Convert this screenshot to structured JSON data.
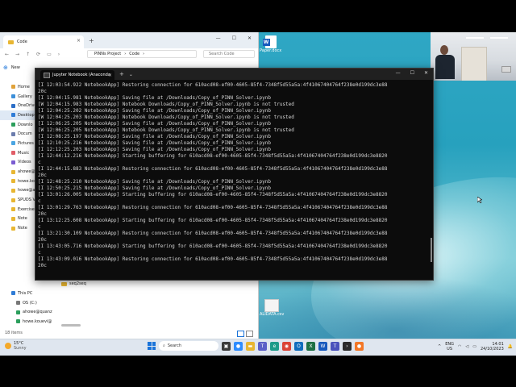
{
  "explorer": {
    "tab_title": "Code",
    "close": "×",
    "new_tab": "+",
    "window_controls": [
      "—",
      "☐",
      "✕"
    ],
    "nav": [
      "←",
      "→",
      "↑",
      "⟳",
      "▭",
      "›"
    ],
    "breadcrumb": [
      "PINNs Project",
      "›",
      "Code",
      "›"
    ],
    "search_placeholder": "Search Code",
    "new_button": "New",
    "sidebar": [
      {
        "label": "Home",
        "color": "#e0a23a"
      },
      {
        "label": "Gallery",
        "color": "#3c8fd9"
      },
      {
        "label": "OneDrive",
        "color": "#2b6ec7"
      },
      {
        "label": "Desktop",
        "color": "#2f7cd6"
      },
      {
        "label": "Downlo",
        "color": "#2b9e5c"
      },
      {
        "label": "Docum",
        "color": "#6b7cad"
      },
      {
        "label": "Pictures",
        "color": "#4aa5e2"
      },
      {
        "label": "Music",
        "color": "#e15d67"
      },
      {
        "label": "Videos",
        "color": "#7a5bd1"
      },
      {
        "label": "ahowe@",
        "color": "#e8b632"
      },
      {
        "label": "howe.koau",
        "color": "#e8b632"
      },
      {
        "label": "howe@ae",
        "color": "#e8b632"
      },
      {
        "label": "SPUDS V",
        "color": "#e8b632"
      },
      {
        "label": "Exercise",
        "color": "#e8b632"
      },
      {
        "label": "Note",
        "color": "#e8b632"
      },
      {
        "label": "Note",
        "color": "#e8b632"
      }
    ],
    "lower_tree": [
      "This PC",
      "OS (C:)",
      "ahowe@quanz",
      "howe.kouevi@"
    ],
    "file": "seq2seq",
    "status": "18 items"
  },
  "desktop": {
    "icons": [
      "Paper.docx",
      "ALIDATA.csv"
    ]
  },
  "terminal": {
    "tab_title": "Jupyter Notebook (Anaconda",
    "close": "×",
    "new_tab": "+",
    "dropdown": "⌄",
    "window_controls": [
      "—",
      "☐",
      "✕"
    ],
    "lines": [
      "[I 12:03:54.922 NotebookApp] Restoring connection for 610acd08-ef00-4605-85f4-7348f5d55a5a:4f41067404764f238e0d199dc3e88",
      "20c",
      "[I 12:04:15.981 NotebookApp] Saving file at /Downloads/Copy_of_PINN_Solver.ipynb",
      "[W 12:04:15.983 NotebookApp] Notebook Downloads/Copy_of_PINN_Solver.ipynb is not trusted",
      "[I 12:04:25.202 NotebookApp] Saving file at /Downloads/Copy_of_PINN_Solver.ipynb",
      "[W 12:04:25.203 NotebookApp] Notebook Downloads/Copy_of_PINN_Solver.ipynb is not trusted",
      "[I 12:06:25.205 NotebookApp] Saving file at /Downloads/Copy_of_PINN_Solver.ipynb",
      "[W 12:06:25.205 NotebookApp] Notebook Downloads/Copy_of_PINN_Solver.ipynb is not trusted",
      "[I 12:08:25.197 NotebookApp] Saving file at /Downloads/Copy_of_PINN_Solver.ipynb",
      "[I 12:10:25.216 NotebookApp] Saving file at /Downloads/Copy_of_PINN_Solver.ipynb",
      "[I 12:12:25.203 NotebookApp] Saving file at /Downloads/Copy_of_PINN_Solver.ipynb",
      "[I 12:44:12.216 NotebookApp] Starting buffering for 610acd08-ef00-4605-85f4-7348f5d55a5a:4f41067404764f238e0d199dc3e8820",
      "c",
      "[I 12:44:15.883 NotebookApp] Restoring connection for 610acd08-ef00-4605-85f4-7348f5d55a5a:4f41067404764f238e0d199dc3e88",
      "20c",
      "[I 12:48:25.210 NotebookApp] Saving file at /Downloads/Copy_of_PINN_Solver.ipynb",
      "[I 12:50:25.215 NotebookApp] Saving file at /Downloads/Copy_of_PINN_Solver.ipynb",
      "[I 13:01:26.005 NotebookApp] Starting buffering for 610acd08-ef00-4605-85f4-7348f5d55a5a:4f41067404764f238e0d199dc3e8820",
      "c",
      "[I 13:01:29.763 NotebookApp] Restoring connection for 610acd08-ef00-4605-85f4-7348f5d55a5a:4f41067404764f238e0d199dc3e88",
      "20c",
      "[I 13:12:25.608 NotebookApp] Starting buffering for 610acd08-ef00-4605-85f4-7348f5d55a5a:4f41067404764f238e0d199dc3e8820",
      "c",
      "[I 13:21:30.109 NotebookApp] Restoring connection for 610acd08-ef00-4605-85f4-7348f5d55a5a:4f41067404764f238e0d199dc3e88",
      "20c",
      "[I 13:43:05.716 NotebookApp] Starting buffering for 610acd08-ef00-4605-85f4-7348f5d55a5a:4f41067404764f238e0d199dc3e8820",
      "c",
      "[I 13:43:09.016 NotebookApp] Restoring connection for 610acd08-ef00-4605-85f4-7348f5d55a5a:4f41067404764f238e0d199dc3e88",
      "20c"
    ]
  },
  "taskbar": {
    "weather_temp": "15°C",
    "weather_desc": "Sunny",
    "search_placeholder": "Search",
    "apps": [
      {
        "name": "task-view",
        "color": "#3b3b3b",
        "glyph": "▣"
      },
      {
        "name": "zoom",
        "color": "#2d8cff",
        "glyph": "●"
      },
      {
        "name": "files",
        "color": "#e8b632",
        "glyph": "▬"
      },
      {
        "name": "teams",
        "color": "#5b5fc7",
        "glyph": "T"
      },
      {
        "name": "edge",
        "color": "#1e9b8a",
        "glyph": "e"
      },
      {
        "name": "chrome",
        "color": "#db4437",
        "glyph": "◉"
      },
      {
        "name": "outlook",
        "color": "#0f6cbd",
        "glyph": "O"
      },
      {
        "name": "excel",
        "color": "#1d7044",
        "glyph": "X"
      },
      {
        "name": "word",
        "color": "#185abd",
        "glyph": "W"
      },
      {
        "name": "teams-2",
        "color": "#4b53bc",
        "glyph": "T"
      },
      {
        "name": "terminal",
        "color": "#2b2b2b",
        "glyph": "›"
      },
      {
        "name": "jupyter",
        "color": "#f37726",
        "glyph": "●"
      }
    ],
    "tray_arrow": "^",
    "lang_1": "ENG",
    "lang_2": "US",
    "time": "14:01",
    "date": "24/10/2023"
  }
}
